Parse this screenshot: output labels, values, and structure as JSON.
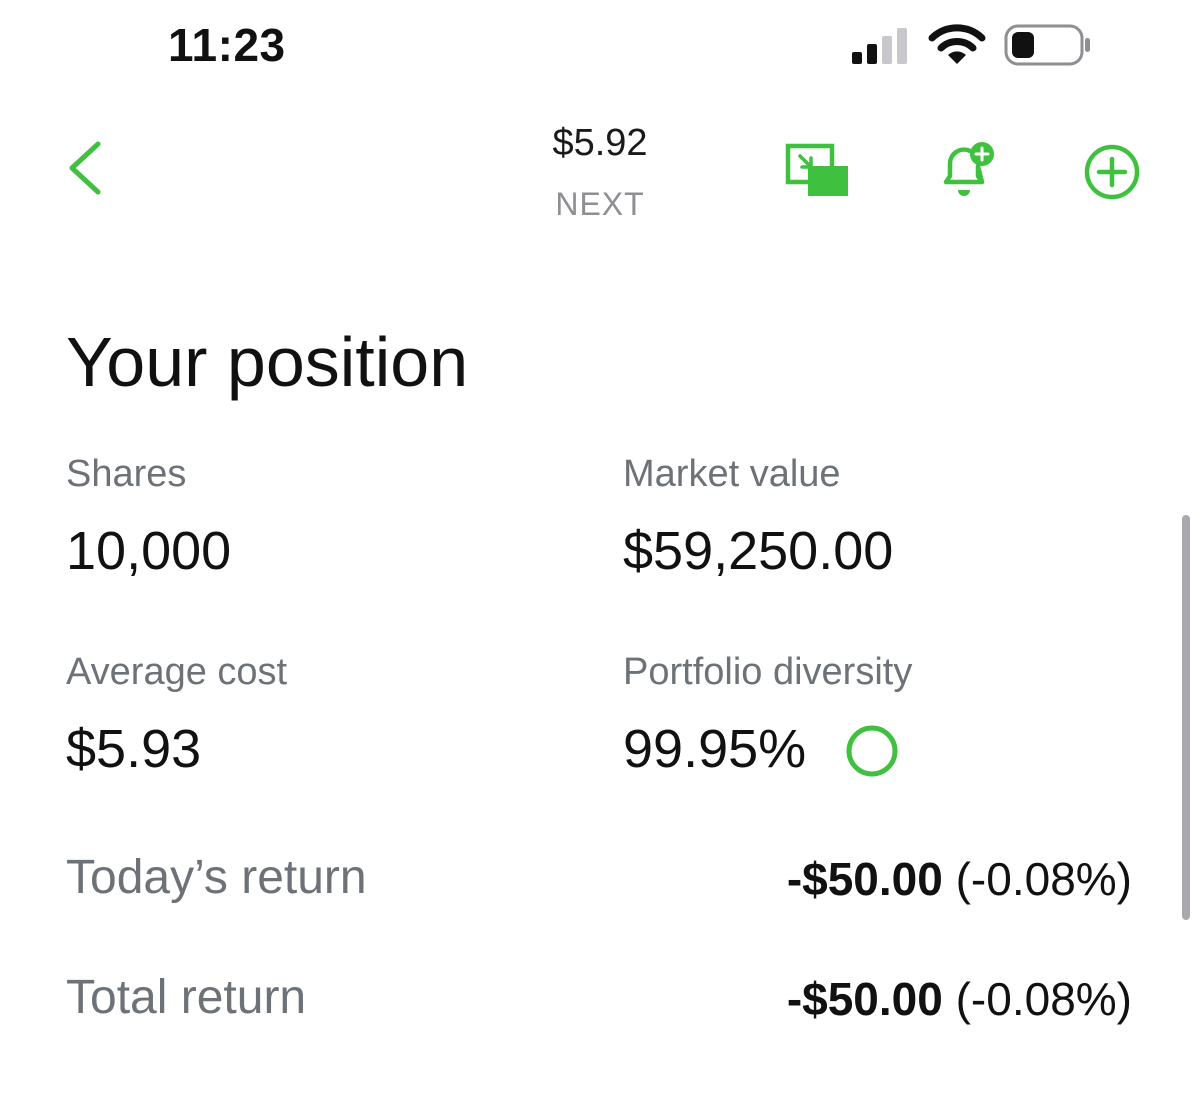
{
  "status_bar": {
    "time": "11:23",
    "signal_icon": "cellular-signal-icon",
    "wifi_icon": "wifi-icon",
    "battery_icon": "battery-icon"
  },
  "nav": {
    "back_icon": "chevron-left-icon",
    "price": "$5.92",
    "ticker": "NEXT",
    "icons": [
      "picture-in-picture-icon",
      "bell-plus-icon",
      "plus-circle-icon"
    ],
    "accent_color": "#3fc03f"
  },
  "position": {
    "title": "Your position",
    "shares_label": "Shares",
    "shares_value": "10,000",
    "market_value_label": "Market value",
    "market_value": "$59,250.00",
    "avg_cost_label": "Average cost",
    "avg_cost_value": "$5.93",
    "diversity_label": "Portfolio diversity",
    "diversity_value": "99.95%",
    "todays_return_label": "Today’s return",
    "todays_return_amount": "-$50.00",
    "todays_return_pct": "(-0.08%)",
    "total_return_label": "Total return",
    "total_return_amount": "-$50.00",
    "total_return_pct": "(-0.08%)"
  }
}
